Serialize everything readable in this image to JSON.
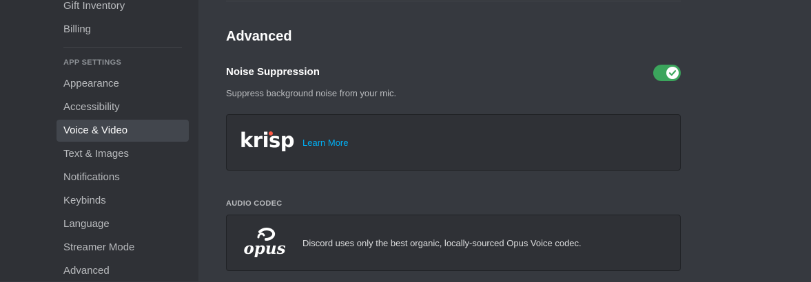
{
  "sidebar": {
    "items_top": [
      {
        "label": "Gift Inventory"
      },
      {
        "label": "Billing"
      }
    ],
    "app_settings_header": "APP SETTINGS",
    "app_items": [
      {
        "label": "Appearance"
      },
      {
        "label": "Accessibility"
      },
      {
        "label": "Voice & Video",
        "selected": true
      },
      {
        "label": "Text & Images"
      },
      {
        "label": "Notifications"
      },
      {
        "label": "Keybinds"
      },
      {
        "label": "Language"
      },
      {
        "label": "Streamer Mode"
      },
      {
        "label": "Advanced"
      }
    ]
  },
  "main": {
    "section_title": "Advanced",
    "noise_suppression": {
      "title": "Noise Suppression",
      "description": "Suppress background noise from your mic.",
      "enabled": true
    },
    "krisp": {
      "logo_text": "krisp",
      "learn_more": "Learn More"
    },
    "audio_codec": {
      "label": "AUDIO CODEC",
      "logo_text": "opus",
      "description": "Discord uses only the best organic, locally-sourced Opus Voice codec."
    }
  },
  "colors": {
    "sidebar_bg": "#2f3136",
    "content_bg": "#36393f",
    "toggle_on": "#3ba55c",
    "link": "#00aff4",
    "krisp_dot": "#ff5a45"
  }
}
